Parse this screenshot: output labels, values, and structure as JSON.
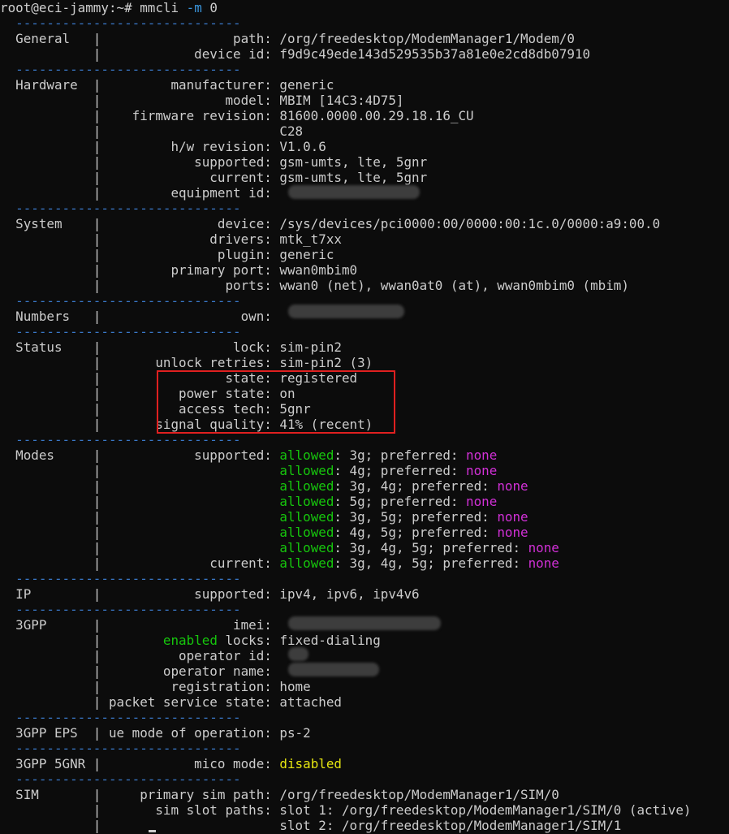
{
  "terminal": {
    "prompt": "root@eci-jammy:~#",
    "command": "mmcli",
    "flag": "-m",
    "arg": "0",
    "separator": "  -----------------------------"
  },
  "sections": {
    "general": {
      "name": "General",
      "path_key": "path",
      "path_val": "/org/freedesktop/ModemManager1/Modem/0",
      "devid_key": "device id",
      "devid_val": "f9d9c49ede143d529535b37a81e0e2cd8db07910"
    },
    "hardware": {
      "name": "Hardware",
      "manufacturer_key": "manufacturer",
      "manufacturer_val": "generic",
      "model_key": "model",
      "model_val": "MBIM [14C3:4D75]",
      "firmware_key": "firmware revision",
      "firmware_val": "81600.0000.00.29.18.16_CU",
      "firmware_val2": "C28",
      "hw_key": "h/w revision",
      "hw_val": "V1.0.6",
      "supported_key": "supported",
      "supported_val": "gsm-umts, lte, 5gnr",
      "current_key": "current",
      "current_val": "gsm-umts, lte, 5gnr",
      "equipid_key": "equipment id"
    },
    "system": {
      "name": "System",
      "device_key": "device",
      "device_val": "/sys/devices/pci0000:00/0000:00:1c.0/0000:a9:00.0",
      "drivers_key": "drivers",
      "drivers_val": "mtk_t7xx",
      "plugin_key": "plugin",
      "plugin_val": "generic",
      "pport_key": "primary port",
      "pport_val": "wwan0mbim0",
      "ports_key": "ports",
      "ports_val": "wwan0 (net), wwan0at0 (at), wwan0mbim0 (mbim)"
    },
    "numbers": {
      "name": "Numbers",
      "own_key": "own"
    },
    "status": {
      "name": "Status",
      "lock_key": "lock",
      "lock_val": "sim-pin2",
      "retries_key": "unlock retries",
      "retries_val": "sim-pin2 (3)",
      "state_key": "state",
      "state_val": "registered",
      "power_key": "power state",
      "power_val": "on",
      "tech_key": "access tech",
      "tech_val": "5gnr",
      "signal_key": "signal quality",
      "signal_val": "41% (recent)"
    },
    "modes": {
      "name": "Modes",
      "supported_key": "supported",
      "current_key": "current",
      "allowed_word": "allowed",
      "preferred_word": "preferred",
      "none_word": "none",
      "rows": [
        "3g",
        "4g",
        "3g, 4g",
        "5g",
        "3g, 5g",
        "4g, 5g",
        "3g, 4g, 5g",
        "3g, 4g, 5g"
      ]
    },
    "ip": {
      "name": "IP",
      "supported_key": "supported",
      "supported_val": "ipv4, ipv6, ipv4v6"
    },
    "gpp": {
      "name": "3GPP",
      "imei_key": "imei",
      "enabled_word": "enabled",
      "locks_key": "locks",
      "locks_val": "fixed-dialing",
      "opid_key": "operator id",
      "opname_key": "operator name",
      "reg_key": "registration",
      "reg_val": "home",
      "pss_key": "packet service state",
      "pss_val": "attached"
    },
    "eps": {
      "name": "3GPP EPS",
      "ue_key": "ue mode of operation",
      "ue_val": "ps-2"
    },
    "nr": {
      "name": "3GPP 5GNR",
      "mico_key": "mico mode",
      "mico_val": "disabled"
    },
    "sim": {
      "name": "SIM",
      "primary_key": "primary sim path",
      "primary_val": "/org/freedesktop/ModemManager1/SIM/0",
      "slots_key": "sim slot paths",
      "slot1_val": "slot 1: /org/freedesktop/ModemManager1/SIM/0 (active)",
      "slot2_val": "slot 2: /org/freedesktop/ModemManager1/SIM/1"
    }
  },
  "colors": {
    "background": "#0c0c0c",
    "text": "#cccccc",
    "separator": "#3a78c8",
    "allowed": "#16c60c",
    "none": "#d130d6",
    "disabled": "#e5e510",
    "highlight_box": "#e02020"
  }
}
